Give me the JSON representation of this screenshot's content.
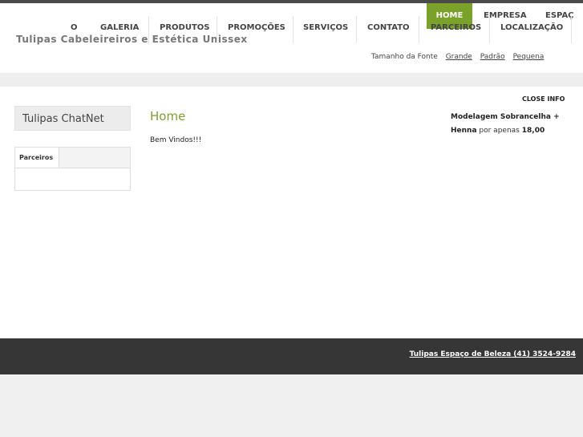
{
  "site": {
    "title": "Tulipas Cabeleireiros e Estética Unissex"
  },
  "nav": {
    "row1": [
      {
        "label": "O"
      },
      {
        "label": "GALERIA"
      },
      {
        "label": "PRODUTOS"
      },
      {
        "label": "PROMOÇÕES"
      },
      {
        "label": "SERVIÇOS"
      },
      {
        "label": "CONTATO"
      },
      {
        "label": "PARCEIROS"
      },
      {
        "label": "LOCALIZAÇÃO"
      }
    ],
    "home": "HOME",
    "empresa": "EMPRESA",
    "espaco": "ESPAÇ"
  },
  "font_size": {
    "label": "Tamanho da Fonte",
    "large": "Grande",
    "default": "Padrão",
    "small": "Pequena"
  },
  "sidebar": {
    "chat_title": "Tulipas ChatNet",
    "partners_tab": "Parceiros"
  },
  "content": {
    "heading": "Home",
    "welcome": "Bem Vindos!!!"
  },
  "info": {
    "close": "CLOSE INFO",
    "promo_bold": "Modelagem Sobrancelha + Henna",
    "promo_text": "por apenas",
    "promo_price": "18,00"
  },
  "footer": {
    "text": "Tulipas Espaço de Beleza (41) 3524-9284"
  }
}
